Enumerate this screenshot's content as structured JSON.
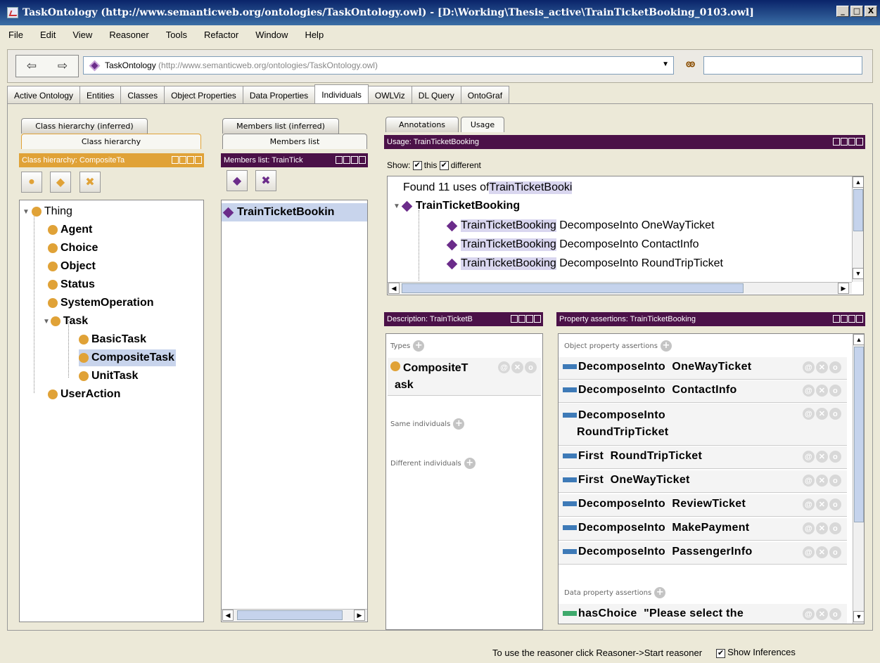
{
  "window": {
    "title": "TaskOntology (http://www.semanticweb.org/ontologies/TaskOntology.owl) - [D:\\Working\\Thesis_active\\TrainTicketBooking_0103.owl]",
    "min": "_",
    "max": "□",
    "close": "X"
  },
  "menu": [
    "File",
    "Edit",
    "View",
    "Reasoner",
    "Tools",
    "Refactor",
    "Window",
    "Help"
  ],
  "toolbar": {
    "back": "⇦",
    "forward": "⇨",
    "ontology_name": "TaskOntology",
    "ontology_iri": "(http://www.semanticweb.org/ontologies/TaskOntology.owl)",
    "search_value": ""
  },
  "tabs": [
    "Active Ontology",
    "Entities",
    "Classes",
    "Object Properties",
    "Data Properties",
    "Individuals",
    "OWLViz",
    "DL Query",
    "OntoGraf"
  ],
  "active_tab": "Individuals",
  "class_panel": {
    "subtab1": "Class hierarchy (inferred)",
    "subtab2": "Class hierarchy",
    "bar": "Class hierarchy: CompositeTa",
    "tree": {
      "root": "Thing",
      "children": [
        "Agent",
        "Choice",
        "Object",
        "Status",
        "SystemOperation",
        "Task",
        "UserAction"
      ],
      "task_children": [
        "BasicTask",
        "CompositeTask",
        "UnitTask"
      ]
    }
  },
  "members_panel": {
    "subtab1": "Members list (inferred)",
    "subtab2": "Members list",
    "bar": "Members list: TrainTick",
    "item": "TrainTicketBookin"
  },
  "usage_panel": {
    "tab1": "Annotations",
    "tab2": "Usage",
    "bar": "Usage: TrainTicketBooking",
    "show_label": "Show:",
    "this_label": "this",
    "different_label": "different",
    "found_prefix": "Found 11 uses of ",
    "found_name": "TrainTicketBooki",
    "root": "TrainTicketBooking",
    "rows": [
      {
        "subject": "TrainTicketBooking",
        "prop": "DecomposeInto",
        "obj": "OneWayTicket"
      },
      {
        "subject": "TrainTicketBooking",
        "prop": "DecomposeInto",
        "obj": "ContactInfo"
      },
      {
        "subject": "TrainTicketBooking",
        "prop": "DecomposeInto",
        "obj": "RoundTripTicket"
      }
    ]
  },
  "description_panel": {
    "bar": "Description: TrainTicketB",
    "types_label": "Types",
    "type_value_1": "CompositeT",
    "type_value_2": "ask",
    "same_label": "Same individuals",
    "different_label": "Different individuals"
  },
  "property_panel": {
    "bar": "Property assertions: TrainTicketBooking",
    "object_label": "Object property assertions",
    "object_rows": [
      {
        "prop": "DecomposeInto",
        "value": "OneWayTicket"
      },
      {
        "prop": "DecomposeInto",
        "value": "ContactInfo"
      },
      {
        "prop": "DecomposeInto",
        "value": "RoundTripTicket"
      },
      {
        "prop": "First",
        "value": "RoundTripTicket"
      },
      {
        "prop": "First",
        "value": "OneWayTicket"
      },
      {
        "prop": "DecomposeInto",
        "value": "ReviewTicket"
      },
      {
        "prop": "DecomposeInto",
        "value": "MakePayment"
      },
      {
        "prop": "DecomposeInto",
        "value": "PassengerInfo"
      }
    ],
    "data_label": "Data property assertions",
    "data_row": {
      "prop": "hasChoice",
      "value": "\"Please select the"
    }
  },
  "status": {
    "hint": "To use the reasoner click Reasoner->Start reasoner",
    "show_inferences": "Show Inferences"
  },
  "colors": {
    "purple": "#4b1148",
    "orange": "#e0a237",
    "individual": "#6b2c8a",
    "object_prop": "#3e7ab7",
    "data_prop": "#3ea96c"
  }
}
